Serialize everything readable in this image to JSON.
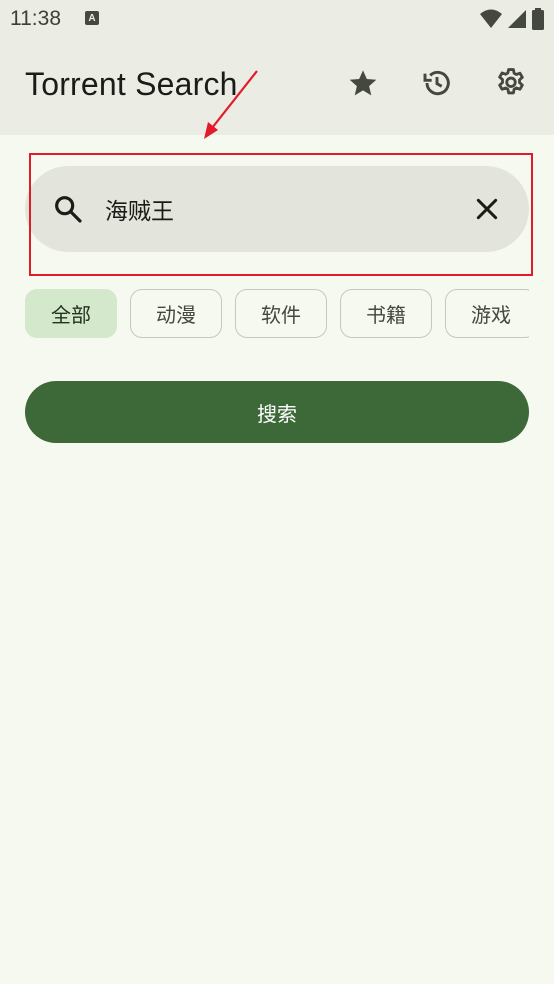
{
  "status_bar": {
    "time": "11:38",
    "notification_glyph": "A",
    "icons": [
      "wifi-icon",
      "signal-icon",
      "battery-icon"
    ]
  },
  "app_bar": {
    "title": "Torrent Search",
    "actions": [
      "star-icon",
      "history-icon",
      "settings-icon"
    ]
  },
  "search": {
    "value": "海贼王",
    "icon": "search-icon",
    "clear_icon": "close-icon"
  },
  "categories": {
    "selected": "全部",
    "items": [
      "全部",
      "动漫",
      "软件",
      "书籍",
      "游戏"
    ]
  },
  "search_button": {
    "label": "搜索"
  },
  "colors": {
    "background": "#f6f9ef",
    "app_bar": "#ebede4",
    "primary": "#3d6838",
    "chip_selected": "#d4e8cc",
    "highlight": "#e21b2a"
  }
}
